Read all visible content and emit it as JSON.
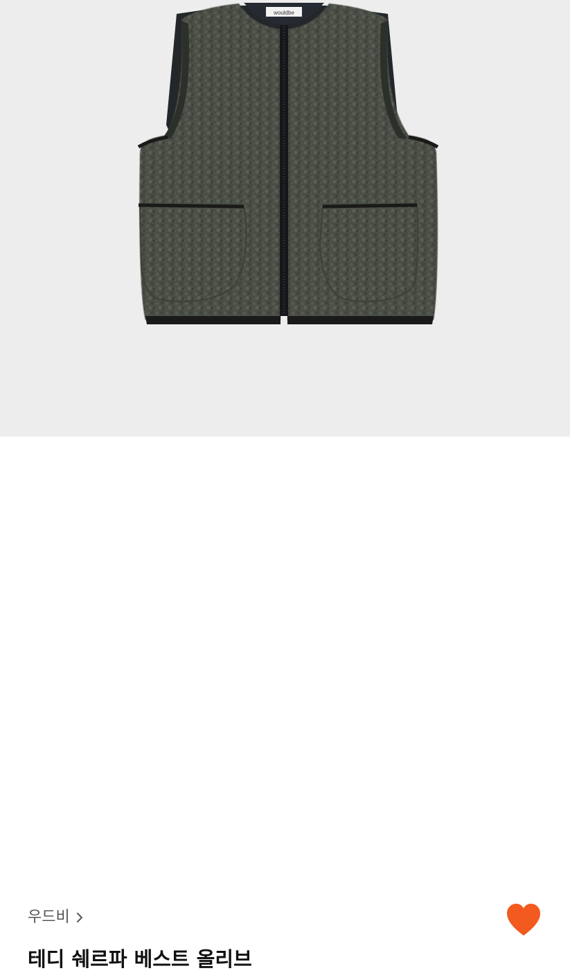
{
  "product": {
    "image": {
      "alt_label": "wouldbe",
      "background": "#ededed",
      "fleece_color": "#494d45",
      "trim_color": "#1a1a1a"
    },
    "brand": "우드비",
    "title": "테디 쉐르파 베스트 올리브",
    "favorite": {
      "icon": "heart-icon",
      "active": true,
      "color": "#f25a1f"
    },
    "brand_link_icon": "chevron-right-icon"
  }
}
